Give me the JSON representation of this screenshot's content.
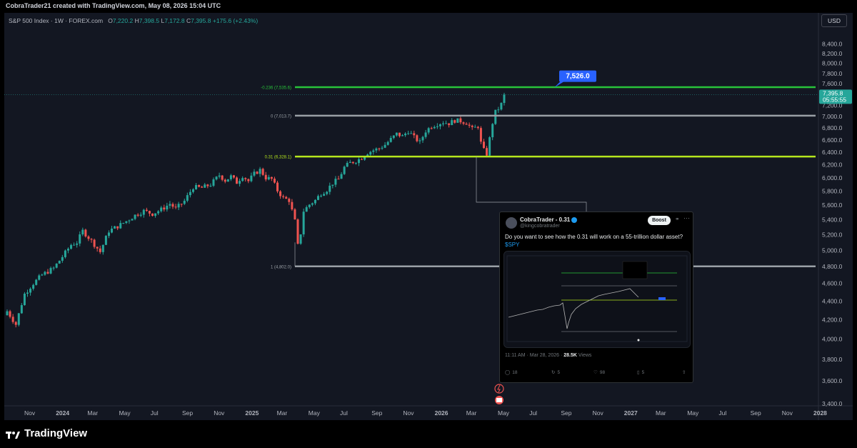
{
  "header": {
    "title": "CobraTrader21 created with TradingView.com, May 08, 2026 15:04 UTC"
  },
  "legend": {
    "symbol": "S&P 500 Index · 1W · FOREX.com",
    "open_label": "O",
    "open": "7,220.2",
    "high_label": "H",
    "high": "7,398.5",
    "low_label": "L",
    "low": "7,172.8",
    "close_label": "C",
    "close": "7,395.8",
    "change": "+175.6 (+2.43%)"
  },
  "currency": "USD",
  "price_badge": {
    "price": "7,395.8",
    "countdown": "05:55:55"
  },
  "target_badge": "7,526.0",
  "brand": "TradingView",
  "colors": {
    "background": "#131722",
    "up": "#26a69a",
    "down": "#ef5350",
    "fib_green": "#28c33a",
    "fib_lime": "#b5e61d",
    "fib_gray": "#9aa0a6",
    "badge_blue": "#2962ff"
  },
  "chart_data": {
    "type": "candlestick",
    "x_ticks": [
      "Nov",
      "2024",
      "Mar",
      "May",
      "Jul",
      "Sep",
      "Nov",
      "2025",
      "Mar",
      "May",
      "Jul",
      "Sep",
      "Nov",
      "2026",
      "Mar",
      "May",
      "Jul",
      "Sep",
      "Nov",
      "2027",
      "Mar",
      "May",
      "Jul",
      "Sep",
      "Nov",
      "2028"
    ],
    "y_ticks": [
      "8,400.0",
      "8,200.0",
      "8,000.0",
      "7,800.0",
      "7,600.0",
      "7,400.0",
      "7,200.0",
      "7,000.0",
      "6,800.0",
      "6,600.0",
      "6,400.0",
      "6,200.0",
      "6,000.0",
      "5,800.0",
      "5,600.0",
      "5,400.0",
      "5,200.0",
      "5,000.0",
      "4,800.0",
      "4,600.0",
      "4,400.0",
      "4,200.0",
      "4,000.0",
      "3,800.0",
      "3,600.0",
      "3,400.0"
    ],
    "y_values": [
      8400,
      8200,
      8000,
      7800,
      7600,
      7400,
      7200,
      7000,
      6800,
      6600,
      6400,
      6200,
      6000,
      5800,
      5600,
      5400,
      5200,
      5000,
      4800,
      4600,
      4400,
      4200,
      4000,
      3800,
      3600,
      3400
    ],
    "ylim": [
      3400,
      8560
    ],
    "log_scale": true,
    "fib_levels": [
      {
        "label": "-0.236 (7,535.6)",
        "value": 7535.6,
        "color": "#28c33a"
      },
      {
        "label": "0 (7,013.7)",
        "value": 7013.7,
        "color": "#9aa0a6"
      },
      {
        "label": "0.31 (6,328.1)",
        "value": 6328.1,
        "color": "#b5e61d"
      },
      {
        "label": "1 (4,802.0)",
        "value": 4802.0,
        "color": "#9aa0a6"
      }
    ],
    "target_value": 7526.0,
    "last_close": 7395.8,
    "weekly_close_anchors": [
      [
        0,
        4290
      ],
      [
        3,
        4150
      ],
      [
        6,
        4480
      ],
      [
        9,
        4600
      ],
      [
        12,
        4700
      ],
      [
        16,
        4780
      ],
      [
        19,
        4920
      ],
      [
        22,
        5070
      ],
      [
        24,
        5100
      ],
      [
        26,
        5250
      ],
      [
        29,
        5120
      ],
      [
        32,
        4980
      ],
      [
        35,
        5250
      ],
      [
        38,
        5310
      ],
      [
        41,
        5380
      ],
      [
        44,
        5460
      ],
      [
        47,
        5520
      ],
      [
        50,
        5480
      ],
      [
        53,
        5540
      ],
      [
        56,
        5620
      ],
      [
        58,
        5550
      ],
      [
        61,
        5660
      ],
      [
        64,
        5860
      ],
      [
        67,
        5850
      ],
      [
        70,
        5900
      ],
      [
        73,
        6040
      ],
      [
        75,
        5960
      ],
      [
        77,
        6020
      ],
      [
        79,
        5930
      ],
      [
        81,
        6030
      ],
      [
        83,
        5950
      ],
      [
        85,
        6060
      ],
      [
        87,
        6120
      ],
      [
        89,
        6000
      ],
      [
        91,
        5980
      ],
      [
        93,
        5810
      ],
      [
        95,
        5700
      ],
      [
        97,
        5670
      ],
      [
        99,
        5380
      ],
      [
        100,
        5060
      ],
      [
        101,
        5220
      ],
      [
        102,
        5520
      ],
      [
        104,
        5610
      ],
      [
        106,
        5670
      ],
      [
        108,
        5770
      ],
      [
        110,
        5820
      ],
      [
        112,
        5920
      ],
      [
        114,
        5980
      ],
      [
        116,
        6160
      ],
      [
        118,
        6230
      ],
      [
        120,
        6260
      ],
      [
        122,
        6310
      ],
      [
        124,
        6390
      ],
      [
        126,
        6430
      ],
      [
        128,
        6460
      ],
      [
        130,
        6520
      ],
      [
        132,
        6610
      ],
      [
        134,
        6700
      ],
      [
        136,
        6660
      ],
      [
        138,
        6750
      ],
      [
        140,
        6640
      ],
      [
        142,
        6560
      ],
      [
        144,
        6750
      ],
      [
        146,
        6830
      ],
      [
        148,
        6870
      ],
      [
        150,
        6900
      ],
      [
        152,
        6880
      ],
      [
        154,
        6930
      ],
      [
        156,
        6920
      ],
      [
        158,
        6890
      ],
      [
        160,
        6780
      ],
      [
        162,
        6830
      ],
      [
        163,
        6550
      ],
      [
        164,
        6430
      ],
      [
        165,
        6370
      ],
      [
        166,
        6620
      ],
      [
        167,
        6890
      ],
      [
        168,
        7080
      ],
      [
        169,
        7140
      ],
      [
        170,
        7220
      ],
      [
        171,
        7395.8
      ]
    ]
  },
  "tweet": {
    "name": "CobraTrader - 0.31",
    "handle": "@kingcobratrader",
    "boost_label": "Boost",
    "text": "Do you want to see how the 0.31 will work on a  55-trillion dollar asset?",
    "cashtag": "$SPY",
    "time": "11:11 AM · Mar 28, 2026 · ",
    "views_count": "28.5K",
    "views_label": " Views",
    "replies": "18",
    "reposts": "5",
    "likes": "98",
    "bookmarks": "5"
  }
}
